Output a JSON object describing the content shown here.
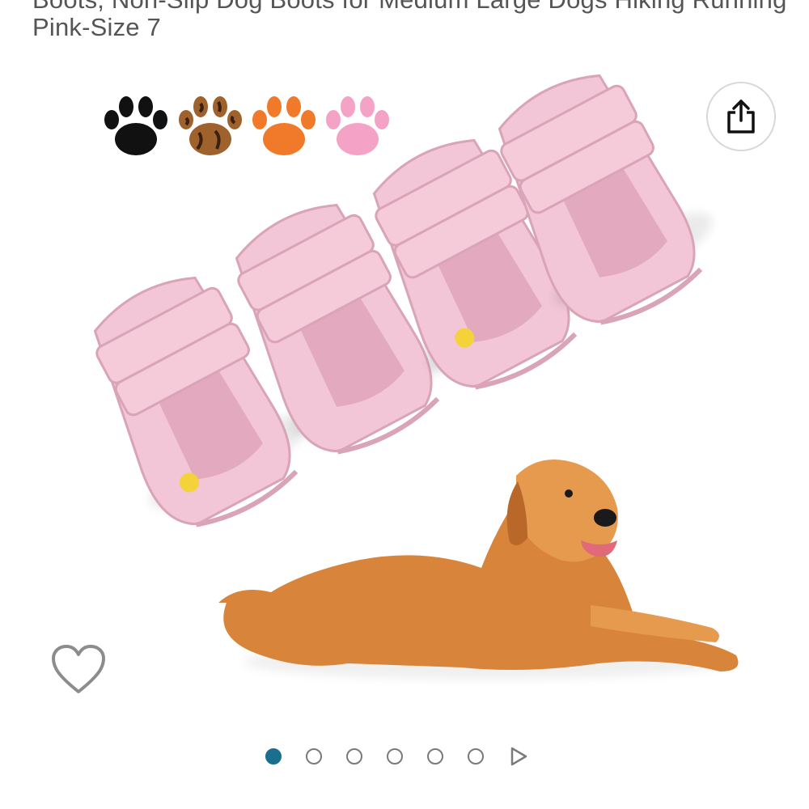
{
  "product": {
    "title_partial": "Boots, Non-Slip Dog Boots for Medium Large Dogs Hiking Running",
    "title_line": "Pink-Size 7"
  },
  "colors": {
    "accent": "#1a6e8e",
    "boot_pink": "#f2c6d6",
    "boot_pink_dark": "#e3a9bf",
    "paw_black": "#111111",
    "paw_leopard": "#a0622c",
    "paw_orange": "#f07a2a",
    "paw_pink": "#f4a3c6",
    "dog_fur": "#d8843a"
  },
  "icons": {
    "share": "share-icon",
    "wishlist": "heart-outline-icon",
    "next": "play-triangle-icon"
  },
  "carousel": {
    "total_images": 6,
    "current_image": 1,
    "next_label": "next"
  }
}
